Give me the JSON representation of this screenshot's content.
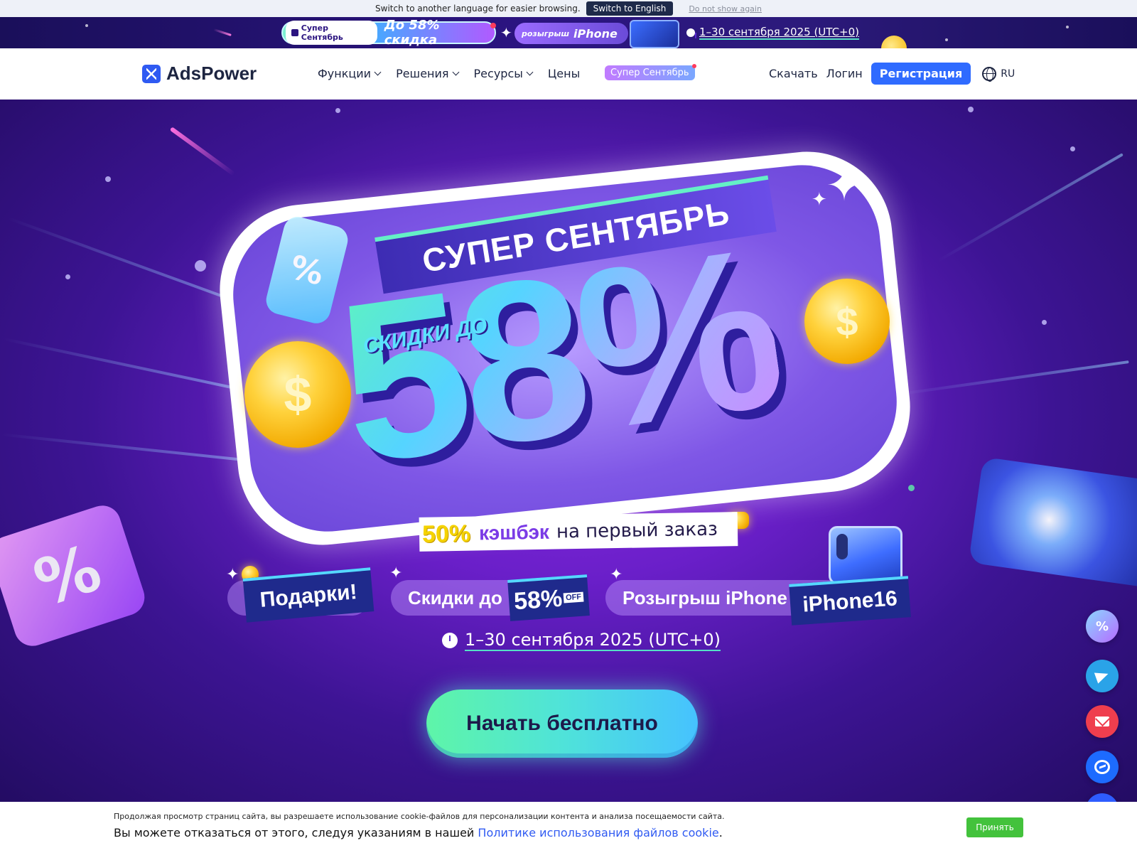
{
  "lang_bar": {
    "message": "Switch to another language for easier browsing.",
    "switch_button": "Switch to English",
    "dismiss_link": "Do not show again"
  },
  "promo_strip": {
    "tag": "Супер Сентябрь",
    "headline": "До 58% скидка",
    "raffle_small": "розыгрыш",
    "raffle_big": "iPhone",
    "date": "1–30 сентября 2025 (UTC+0)"
  },
  "header": {
    "logo_text": "AdsPower",
    "nav": [
      {
        "label": "Функции"
      },
      {
        "label": "Решения"
      },
      {
        "label": "Ресурсы"
      },
      {
        "label": "Цены"
      }
    ],
    "super_sept_badge": "Супер Сентябрь",
    "download": "Скачать",
    "login": "Логин",
    "register": "Регистрация",
    "language": "RU"
  },
  "hero": {
    "banner_title": "СУПЕР СЕНТЯБРЬ",
    "discount_prefix": "СКИДКИ ДО",
    "discount_value": "58%",
    "bottle_symbol": "%",
    "coin_symbol": "$",
    "cashback": {
      "percent": "50%",
      "word": "кэшбэк",
      "rest": "на первый заказ"
    },
    "features": {
      "gifts_label": "Подарки!",
      "discount_text": "Скидки до",
      "discount_box": "58%",
      "discount_box_small": "OFF",
      "raffle_text": "Розыгрыш iPhone",
      "raffle_box": "iPhone16"
    },
    "date": "1–30 сентября 2025 (UTC+0)",
    "cta": "Начать бесплатно"
  },
  "cookie_bar": {
    "line1": "Продолжая просмотр страниц сайта, вы разрешаете использование cookie-файлов для персонализации контента и анализа посещаемости сайта.",
    "line2_prefix": "Вы можете отказаться от этого, следуя указаниям в нашей",
    "line2_link": "Политике использования файлов cookie",
    "line2_suffix": ".",
    "accept": "Принять"
  },
  "colors": {
    "brand_blue": "#2f6bff",
    "accept_green": "#43c23c",
    "hero_purple": "#6a1fc9"
  },
  "icons": [
    "clock-icon",
    "globe-icon",
    "gift-icon",
    "chevron-down-icon",
    "telegram-icon",
    "mail-icon",
    "messenger-icon",
    "promo-icon"
  ]
}
